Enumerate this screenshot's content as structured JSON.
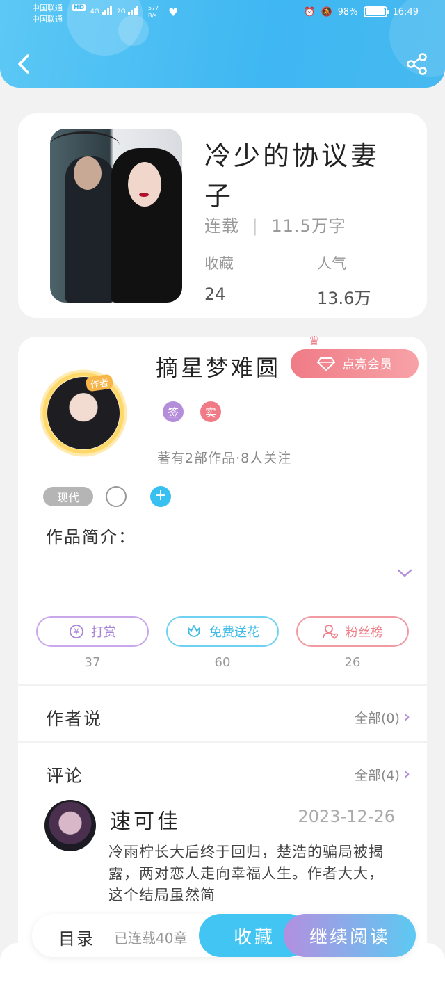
{
  "status_bar": {
    "carrier_1": "中国联通",
    "carrier_2": "中国联通",
    "hd": "HD",
    "signal_1": "4G",
    "signal_2": "2G",
    "speed_1": "577",
    "speed_2": "B/s",
    "battery": "98%",
    "battery_level": 0.98,
    "time": "16:49"
  },
  "book": {
    "title": "冷少的协议妻子",
    "status": "连载",
    "word_count": "11.5万字",
    "favorites_label": "收藏",
    "favorites_value": "24",
    "popularity_label": "人气",
    "popularity_value": "13.6万"
  },
  "author": {
    "tag": "作者",
    "name": "摘星梦难圆",
    "vip_button": "点亮会员",
    "badge_sign": "签",
    "badge_real": "实",
    "stats": "著有2部作品·8人关注"
  },
  "genre_tag": "现代",
  "intro_label": "作品简介：",
  "actions": {
    "tip_label": "打赏",
    "tip_count": "37",
    "flower_label": "免费送花",
    "flower_count": "60",
    "fans_label": "粉丝榜",
    "fans_count": "26"
  },
  "author_says": {
    "title": "作者说",
    "link": "全部(0)"
  },
  "comments": {
    "title": "评论",
    "link": "全部(4)",
    "items": [
      {
        "name": "速可佳",
        "date": "2023-12-26",
        "text": "冷雨柠长大后终于回归，楚浩的骗局被揭露，两对恋人走向幸福人生。作者大大，这个结局虽然简"
      }
    ]
  },
  "bottom_bar": {
    "toc": "目录",
    "chapter_count": "已连载40章",
    "favorite_button": "收藏",
    "read_button": "继续阅读"
  },
  "colors": {
    "header": "#3fb7f2",
    "accent_purple": "#b48ddb",
    "accent_cyan": "#38c0f0",
    "accent_red": "#f07b86"
  }
}
